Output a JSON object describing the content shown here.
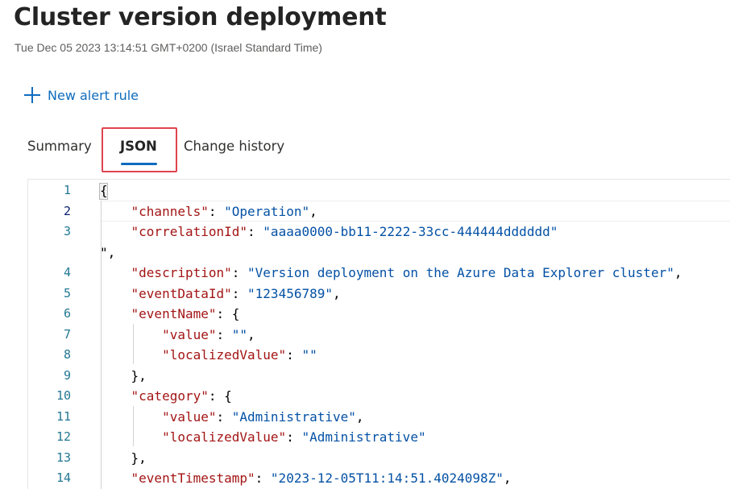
{
  "page": {
    "title": "Cluster version deployment",
    "subtitle": "Tue Dec 05 2023 13:14:51 GMT+0200 (Israel Standard Time)"
  },
  "toolbar": {
    "new_alert_rule_label": "New alert rule",
    "new_alert_rule_icon": "plus-icon"
  },
  "tabs": [
    {
      "label": "Summary",
      "selected": false
    },
    {
      "label": "JSON",
      "selected": true
    },
    {
      "label": "Change history",
      "selected": false
    }
  ],
  "colors": {
    "accent": "#0f6cbd",
    "highlight_border": "#e0434f",
    "json_key": "#a31515",
    "json_string": "#0451a5",
    "line_number": "#237893"
  },
  "editor": {
    "current_line": 2,
    "lines": [
      {
        "n": "1",
        "segments": [
          {
            "t": "{",
            "c": "p"
          }
        ]
      },
      {
        "n": "2",
        "segments": [
          {
            "t": "    ",
            "c": "p"
          },
          {
            "t": "\"channels\"",
            "c": "k"
          },
          {
            "t": ": ",
            "c": "p"
          },
          {
            "t": "\"Operation\"",
            "c": "s"
          },
          {
            "t": ",",
            "c": "p"
          }
        ]
      },
      {
        "n": "3",
        "segments": [
          {
            "t": "    ",
            "c": "p"
          },
          {
            "t": "\"correlationId\"",
            "c": "k"
          },
          {
            "t": ": ",
            "c": "p"
          },
          {
            "t": "\"aaaa0000-bb11-2222-33cc-444444dddddd\"",
            "c": "s"
          }
        ]
      },
      {
        "n": "",
        "segments": [
          {
            "t": "\",",
            "c": "p"
          }
        ]
      },
      {
        "n": "4",
        "segments": [
          {
            "t": "    ",
            "c": "p"
          },
          {
            "t": "\"description\"",
            "c": "k"
          },
          {
            "t": ": ",
            "c": "p"
          },
          {
            "t": "\"Version deployment on the Azure Data Explorer cluster\"",
            "c": "s"
          },
          {
            "t": ",",
            "c": "p"
          }
        ]
      },
      {
        "n": "5",
        "segments": [
          {
            "t": "    ",
            "c": "p"
          },
          {
            "t": "\"eventDataId\"",
            "c": "k"
          },
          {
            "t": ": ",
            "c": "p"
          },
          {
            "t": "\"123456789\"",
            "c": "s"
          },
          {
            "t": ",",
            "c": "p"
          }
        ]
      },
      {
        "n": "6",
        "segments": [
          {
            "t": "    ",
            "c": "p"
          },
          {
            "t": "\"eventName\"",
            "c": "k"
          },
          {
            "t": ": {",
            "c": "p"
          }
        ]
      },
      {
        "n": "7",
        "segments": [
          {
            "t": "        ",
            "c": "p"
          },
          {
            "t": "\"value\"",
            "c": "k"
          },
          {
            "t": ": ",
            "c": "p"
          },
          {
            "t": "\"\"",
            "c": "s"
          },
          {
            "t": ",",
            "c": "p"
          }
        ]
      },
      {
        "n": "8",
        "segments": [
          {
            "t": "        ",
            "c": "p"
          },
          {
            "t": "\"localizedValue\"",
            "c": "k"
          },
          {
            "t": ": ",
            "c": "p"
          },
          {
            "t": "\"\"",
            "c": "s"
          }
        ]
      },
      {
        "n": "9",
        "segments": [
          {
            "t": "    },",
            "c": "p"
          }
        ]
      },
      {
        "n": "10",
        "segments": [
          {
            "t": "    ",
            "c": "p"
          },
          {
            "t": "\"category\"",
            "c": "k"
          },
          {
            "t": ": {",
            "c": "p"
          }
        ]
      },
      {
        "n": "11",
        "segments": [
          {
            "t": "        ",
            "c": "p"
          },
          {
            "t": "\"value\"",
            "c": "k"
          },
          {
            "t": ": ",
            "c": "p"
          },
          {
            "t": "\"Administrative\"",
            "c": "s"
          },
          {
            "t": ",",
            "c": "p"
          }
        ]
      },
      {
        "n": "12",
        "segments": [
          {
            "t": "        ",
            "c": "p"
          },
          {
            "t": "\"localizedValue\"",
            "c": "k"
          },
          {
            "t": ": ",
            "c": "p"
          },
          {
            "t": "\"Administrative\"",
            "c": "s"
          }
        ]
      },
      {
        "n": "13",
        "segments": [
          {
            "t": "    },",
            "c": "p"
          }
        ]
      },
      {
        "n": "14",
        "segments": [
          {
            "t": "    ",
            "c": "p"
          },
          {
            "t": "\"eventTimestamp\"",
            "c": "k"
          },
          {
            "t": ": ",
            "c": "p"
          },
          {
            "t": "\"2023-12-05T11:14:51.4024098Z\"",
            "c": "s"
          },
          {
            "t": ",",
            "c": "p"
          }
        ]
      }
    ]
  }
}
